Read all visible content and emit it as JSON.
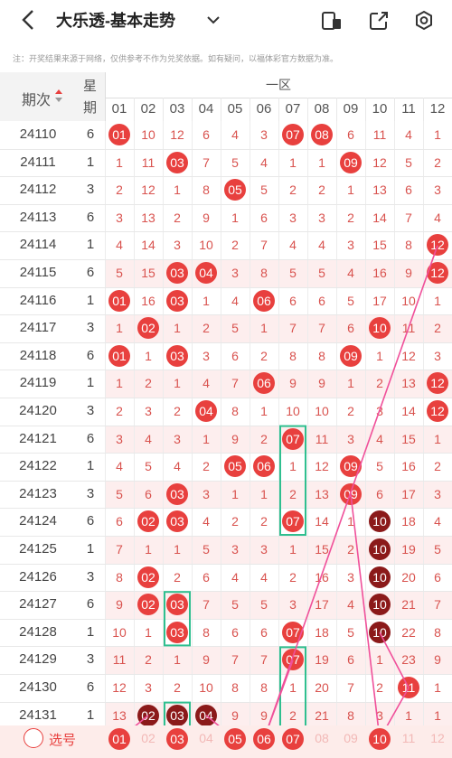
{
  "header": {
    "title": "大乐透-基本走势"
  },
  "note": "注：开奖结果来源于网络，仅供参考不作为兑奖依据。如有疑问，以福体彩官方数据为准。",
  "table_header": {
    "issue": "期次",
    "week_line1": "星",
    "week_line2": "期",
    "zone": "一区",
    "numbers": [
      "01",
      "02",
      "03",
      "04",
      "05",
      "06",
      "07",
      "08",
      "09",
      "10",
      "11",
      "12"
    ]
  },
  "rows": [
    {
      "issue": "24110",
      "week": "6",
      "cells": [
        "01",
        "10",
        "12",
        "6",
        "4",
        "3",
        "07",
        "08",
        "6",
        "11",
        "4",
        "1"
      ],
      "balls": [
        0,
        6,
        7
      ]
    },
    {
      "issue": "24111",
      "week": "1",
      "cells": [
        "1",
        "11",
        "03",
        "7",
        "5",
        "4",
        "1",
        "1",
        "09",
        "12",
        "5",
        "2"
      ],
      "balls": [
        2,
        8
      ]
    },
    {
      "issue": "24112",
      "week": "3",
      "cells": [
        "2",
        "12",
        "1",
        "8",
        "05",
        "5",
        "2",
        "2",
        "1",
        "13",
        "6",
        "3"
      ],
      "balls": [
        4
      ]
    },
    {
      "issue": "24113",
      "week": "6",
      "cells": [
        "3",
        "13",
        "2",
        "9",
        "1",
        "6",
        "3",
        "3",
        "2",
        "14",
        "7",
        "4"
      ],
      "balls": []
    },
    {
      "issue": "24114",
      "week": "1",
      "cells": [
        "4",
        "14",
        "3",
        "10",
        "2",
        "7",
        "4",
        "4",
        "3",
        "15",
        "8",
        "12"
      ],
      "balls": [
        11
      ]
    },
    {
      "issue": "24115",
      "week": "6",
      "cells": [
        "5",
        "15",
        "03",
        "04",
        "3",
        "8",
        "5",
        "5",
        "4",
        "16",
        "9",
        "12"
      ],
      "balls": [
        2,
        3,
        11
      ]
    },
    {
      "issue": "24116",
      "week": "1",
      "cells": [
        "01",
        "16",
        "03",
        "1",
        "4",
        "06",
        "6",
        "6",
        "5",
        "17",
        "10",
        "1"
      ],
      "balls": [
        0,
        2,
        5
      ]
    },
    {
      "issue": "24117",
      "week": "3",
      "cells": [
        "1",
        "02",
        "1",
        "2",
        "5",
        "1",
        "7",
        "7",
        "6",
        "10",
        "11",
        "2"
      ],
      "balls": [
        1,
        9
      ]
    },
    {
      "issue": "24118",
      "week": "6",
      "cells": [
        "01",
        "1",
        "03",
        "3",
        "6",
        "2",
        "8",
        "8",
        "09",
        "1",
        "12",
        "3"
      ],
      "balls": [
        0,
        2,
        8
      ]
    },
    {
      "issue": "24119",
      "week": "1",
      "cells": [
        "1",
        "2",
        "1",
        "4",
        "7",
        "06",
        "9",
        "9",
        "1",
        "2",
        "13",
        "12"
      ],
      "balls": [
        5,
        11
      ]
    },
    {
      "issue": "24120",
      "week": "3",
      "cells": [
        "2",
        "3",
        "2",
        "04",
        "8",
        "1",
        "10",
        "10",
        "2",
        "3",
        "14",
        "12"
      ],
      "balls": [
        3,
        11
      ]
    },
    {
      "issue": "24121",
      "week": "6",
      "cells": [
        "3",
        "4",
        "3",
        "1",
        "9",
        "2",
        "07",
        "11",
        "3",
        "4",
        "15",
        "1"
      ],
      "balls": [
        6
      ]
    },
    {
      "issue": "24122",
      "week": "1",
      "cells": [
        "4",
        "5",
        "4",
        "2",
        "05",
        "06",
        "1",
        "12",
        "09",
        "5",
        "16",
        "2"
      ],
      "balls": [
        4,
        5,
        8
      ]
    },
    {
      "issue": "24123",
      "week": "3",
      "cells": [
        "5",
        "6",
        "03",
        "3",
        "1",
        "1",
        "2",
        "13",
        "09",
        "6",
        "17",
        "3"
      ],
      "balls": [
        2,
        8
      ]
    },
    {
      "issue": "24124",
      "week": "6",
      "cells": [
        "6",
        "02",
        "03",
        "4",
        "2",
        "2",
        "07",
        "14",
        "1",
        "10",
        "18",
        "4"
      ],
      "balls": [
        1,
        2,
        6,
        9
      ]
    },
    {
      "issue": "24125",
      "week": "1",
      "cells": [
        "7",
        "1",
        "1",
        "5",
        "3",
        "3",
        "1",
        "15",
        "2",
        "10",
        "19",
        "5"
      ],
      "balls": [
        9
      ]
    },
    {
      "issue": "24126",
      "week": "3",
      "cells": [
        "8",
        "02",
        "2",
        "6",
        "4",
        "4",
        "2",
        "16",
        "3",
        "10",
        "20",
        "6"
      ],
      "balls": [
        1,
        9
      ]
    },
    {
      "issue": "24127",
      "week": "6",
      "cells": [
        "9",
        "02",
        "03",
        "7",
        "5",
        "5",
        "3",
        "17",
        "4",
        "10",
        "21",
        "7"
      ],
      "balls": [
        1,
        2,
        9
      ]
    },
    {
      "issue": "24128",
      "week": "1",
      "cells": [
        "10",
        "1",
        "03",
        "8",
        "6",
        "6",
        "07",
        "18",
        "5",
        "10",
        "22",
        "8"
      ],
      "balls": [
        2,
        6,
        9
      ]
    },
    {
      "issue": "24129",
      "week": "3",
      "cells": [
        "11",
        "2",
        "1",
        "9",
        "7",
        "7",
        "07",
        "19",
        "6",
        "1",
        "23",
        "9"
      ],
      "balls": [
        6
      ]
    },
    {
      "issue": "24130",
      "week": "6",
      "cells": [
        "12",
        "3",
        "2",
        "10",
        "8",
        "8",
        "1",
        "20",
        "7",
        "2",
        "11",
        "1"
      ],
      "balls": [
        10
      ]
    },
    {
      "issue": "24131",
      "week": "1",
      "cells": [
        "13",
        "02",
        "03",
        "04",
        "9",
        "9",
        "2",
        "21",
        "8",
        "3",
        "1",
        "1"
      ],
      "balls": [
        1,
        2,
        3
      ]
    }
  ],
  "dark_balls": {
    "24124": [
      9
    ],
    "24125": [
      9
    ],
    "24126": [
      9
    ],
    "24127": [
      9
    ],
    "24128": [
      9
    ],
    "24131": [
      1,
      2,
      3
    ]
  },
  "selector": {
    "label": "选号",
    "numbers": [
      "01",
      "02",
      "03",
      "04",
      "05",
      "06",
      "07",
      "08",
      "09",
      "10",
      "11",
      "12"
    ],
    "selected": [
      0,
      2,
      4,
      5,
      6,
      9
    ]
  },
  "colors": {
    "ball": "#e8403e",
    "ball_dark": "#8b1a1a",
    "teal_box": "#2fbf8f",
    "arrow": "#f0509a"
  }
}
